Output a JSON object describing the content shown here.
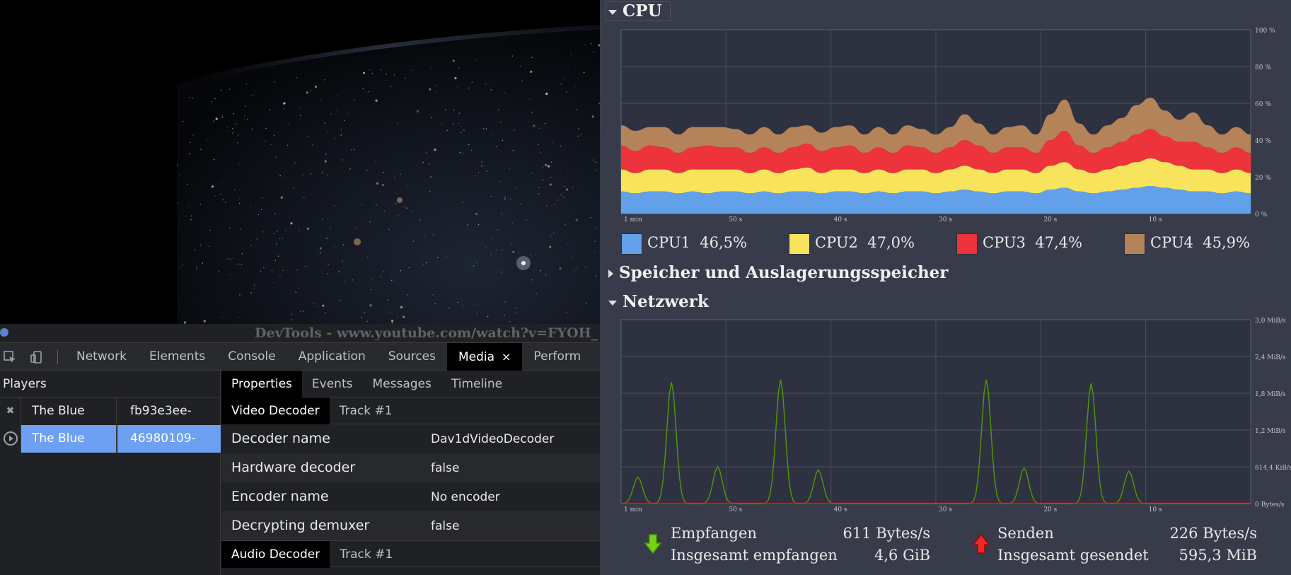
{
  "devtools": {
    "title": "DevTools - www.youtube.com/watch?v=FYOH_",
    "tabs": [
      {
        "label": "Network"
      },
      {
        "label": "Elements"
      },
      {
        "label": "Console"
      },
      {
        "label": "Application"
      },
      {
        "label": "Sources"
      },
      {
        "label": "Media",
        "active": true,
        "close": "×"
      },
      {
        "label": "Perform"
      }
    ],
    "players_header": "Players",
    "players": [
      {
        "name": "The Blue",
        "id": "fb93e3ee-",
        "icon": "close-icon"
      },
      {
        "name": "The Blue",
        "id": "46980109-",
        "icon": "play-circle-icon",
        "selected": true
      }
    ],
    "subtabs": [
      "Properties",
      "Events",
      "Messages",
      "Timeline"
    ],
    "video_section": {
      "tab": "Video Decoder",
      "track": "Track #1"
    },
    "properties": [
      {
        "key": "Decoder name",
        "value": "Dav1dVideoDecoder"
      },
      {
        "key": "Hardware decoder",
        "value": "false"
      },
      {
        "key": "Encoder name",
        "value": "No encoder"
      },
      {
        "key": "Decrypting demuxer",
        "value": "false"
      }
    ],
    "audio_section": {
      "tab": "Audio Decoder",
      "track": "Track #1"
    }
  },
  "monitor": {
    "cpu_header": "CPU",
    "memory_header": "Speicher und Auslagerungsspeicher",
    "network_header": "Netzwerk",
    "cpu_legend": [
      {
        "name": "CPU1",
        "value": "46,5%",
        "color": "#62a0ea"
      },
      {
        "name": "CPU2",
        "value": "47,0%",
        "color": "#f8e45c"
      },
      {
        "name": "CPU3",
        "value": "47,4%",
        "color": "#ed333b"
      },
      {
        "name": "CPU4",
        "value": "45,9%",
        "color": "#b5835a"
      }
    ],
    "network": {
      "received_label": "Empfangen",
      "received_value": "611 Bytes/s",
      "total_received_label": "Insgesamt empfangen",
      "total_received_value": "4,6 GiB",
      "sent_label": "Senden",
      "sent_value": "226 Bytes/s",
      "total_sent_label": "Insgesamt gesendet",
      "total_sent_value": "595,3 MiB",
      "received_color": "#4e9a06",
      "sent_color": "#cc0000"
    }
  },
  "chart_data": [
    {
      "type": "area",
      "stacked": true,
      "x_tick_labels": [
        "1 min",
        "50 s",
        "40 s",
        "30 s",
        "20 s",
        "10 s"
      ],
      "y_tick_labels": [
        "100 %",
        "80 %",
        "60 %",
        "40 %",
        "20 %",
        "0 %"
      ],
      "ylim": [
        0,
        100
      ],
      "grid": true,
      "series": [
        {
          "name": "CPU1",
          "color": "#62a0ea",
          "values": [
            12,
            11,
            12,
            12,
            11,
            12,
            11,
            12,
            12,
            11,
            12,
            11,
            12,
            12,
            11,
            12,
            12,
            11,
            12,
            11,
            12,
            12,
            11,
            12,
            13,
            12,
            11,
            12,
            12,
            11,
            13,
            14,
            12,
            11,
            12,
            13,
            14,
            15,
            14,
            13,
            12,
            12,
            11,
            12,
            11
          ]
        },
        {
          "name": "CPU2",
          "color": "#f8e45c",
          "values": [
            12,
            11,
            12,
            12,
            11,
            12,
            13,
            12,
            12,
            11,
            12,
            11,
            12,
            13,
            11,
            12,
            12,
            11,
            12,
            11,
            12,
            12,
            11,
            12,
            13,
            12,
            11,
            12,
            12,
            11,
            13,
            14,
            12,
            11,
            12,
            13,
            14,
            15,
            14,
            13,
            12,
            12,
            11,
            12,
            11
          ]
        },
        {
          "name": "CPU3",
          "color": "#ed333b",
          "values": [
            13,
            12,
            13,
            12,
            11,
            12,
            13,
            12,
            12,
            11,
            12,
            11,
            12,
            13,
            12,
            12,
            13,
            11,
            12,
            11,
            13,
            12,
            11,
            12,
            14,
            13,
            11,
            12,
            12,
            11,
            14,
            17,
            13,
            11,
            12,
            13,
            15,
            16,
            14,
            13,
            15,
            12,
            11,
            12,
            11
          ]
        },
        {
          "name": "CPU4",
          "color": "#b5835a",
          "values": [
            11,
            11,
            10,
            11,
            10,
            11,
            10,
            11,
            10,
            10,
            11,
            10,
            11,
            10,
            10,
            11,
            11,
            10,
            11,
            10,
            11,
            10,
            10,
            11,
            14,
            12,
            10,
            11,
            12,
            10,
            14,
            17,
            12,
            10,
            12,
            13,
            16,
            17,
            14,
            12,
            16,
            12,
            10,
            11,
            10
          ]
        }
      ]
    },
    {
      "type": "line",
      "x_tick_labels": [
        "1 min",
        "50 s",
        "40 s",
        "30 s",
        "20 s",
        "10 s"
      ],
      "y_tick_labels": [
        "3,0 MiB/s",
        "2,4 MiB/s",
        "1,8 MiB/s",
        "1,2 MiB/s",
        "614,4 KiB/s",
        "0 Bytes/s"
      ],
      "grid": true,
      "series": [
        {
          "name": "Empfangen",
          "color": "#4e9a06",
          "x_peaks": [
            4,
            12,
            23,
            38,
            47,
            62,
            70,
            87,
            96,
            112,
            121,
            134,
            146
          ],
          "y_peaks": [
            0.43,
            1.98,
            0.6,
            2.02,
            0.55,
            0.0,
            0.0,
            2.02,
            0.58,
            1.96,
            0.53,
            0.0,
            0.0
          ]
        },
        {
          "name": "Senden",
          "color": "#cc0000",
          "values": [
            0
          ]
        }
      ]
    }
  ]
}
